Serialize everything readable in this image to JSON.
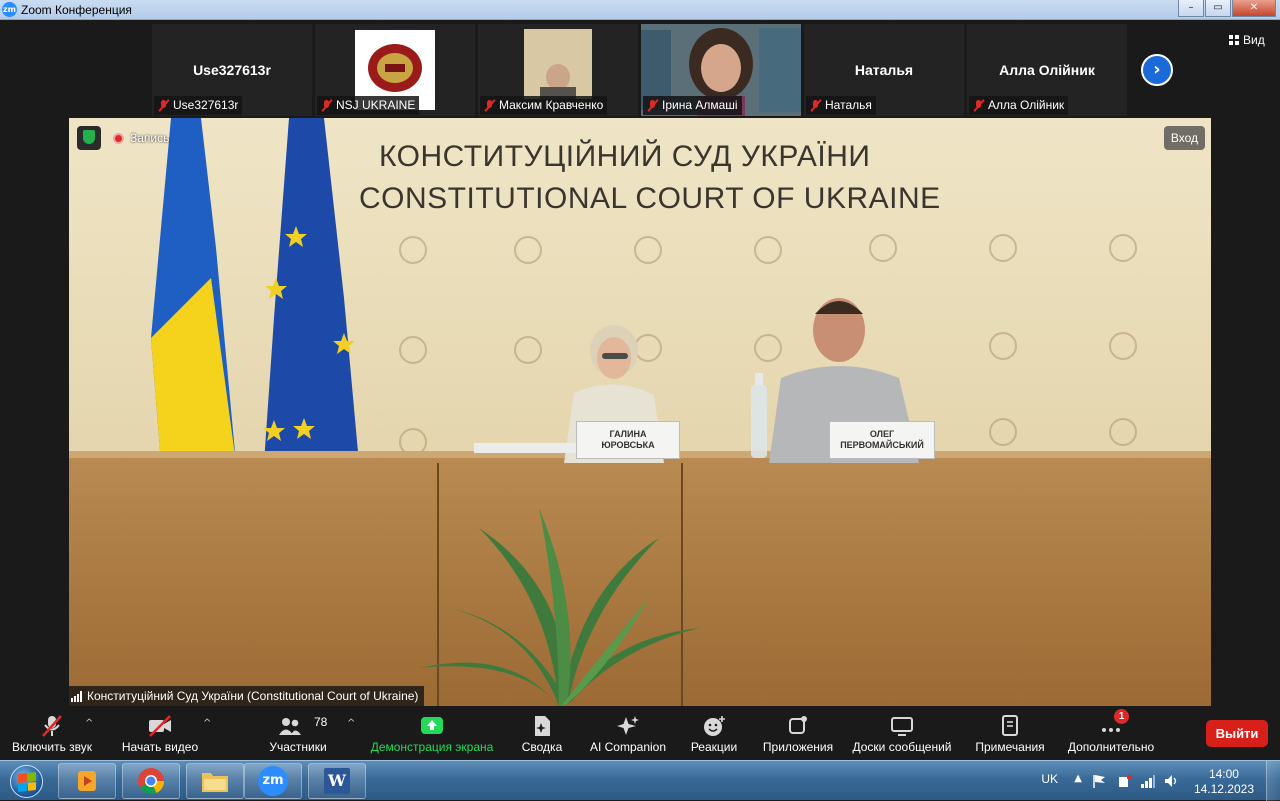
{
  "window": {
    "title": "Zoom Конференция",
    "logo_text": "zm",
    "controls": [
      "–",
      "▭",
      "✕"
    ]
  },
  "strip": {
    "tiles": [
      {
        "name_big": "Use327613r",
        "label": "Use327613r",
        "kind": "name"
      },
      {
        "name_big": "",
        "label": "NSJ UKRAINE",
        "kind": "logo"
      },
      {
        "name_big": "",
        "label": "Максим Кравченко",
        "kind": "photo"
      },
      {
        "name_big": "",
        "label": "Ірина Алмаші",
        "kind": "photo"
      },
      {
        "name_big": "Наталья",
        "label": "Наталья",
        "kind": "name"
      },
      {
        "name_big": "Алла Олійник",
        "label": "Алла Олійник",
        "kind": "name"
      }
    ],
    "next_icon": "›",
    "view_label": "Вид"
  },
  "stage": {
    "heading_ua": "КОНСТИТУЦІЙНИЙ СУД УКРАЇНИ",
    "heading_en": "CONSTITUTIONAL COURT OF UKRAINE",
    "recording_label": "Запись",
    "enter_label": "Вход",
    "speaker_label": "Конституційний Суд України (Constitutional Court of Ukraine)",
    "nameplate_1": "ГАЛИНА\nЮРОВСЬКА",
    "nameplate_2": "ОЛЕГ\nПЕРВОМАЙСЬКИЙ",
    "colors": {
      "ua_blue": "#1f5fc4",
      "ua_yellow": "#f5d21b",
      "eu_blue": "#1d4aa8",
      "eu_star": "#f2d023"
    }
  },
  "toolbar": {
    "items": [
      {
        "label": "Включить звук",
        "icon": "mic-muted-icon"
      },
      {
        "label": "Начать видео",
        "icon": "video-off-icon"
      },
      {
        "label": "Участники",
        "icon": "participants-icon",
        "count": "78"
      },
      {
        "label": "Демонстрация экрана",
        "icon": "share-screen-icon"
      },
      {
        "label": "Сводка",
        "icon": "summary-icon"
      },
      {
        "label": "AI Companion",
        "icon": "ai-companion-icon"
      },
      {
        "label": "Реакции",
        "icon": "reactions-icon"
      },
      {
        "label": "Приложения",
        "icon": "apps-icon"
      },
      {
        "label": "Доски сообщений",
        "icon": "whiteboards-icon"
      },
      {
        "label": "Примечания",
        "icon": "notes-icon"
      },
      {
        "label": "Дополнительно",
        "icon": "more-icon",
        "badge": "1"
      }
    ],
    "leave_label": "Выйти",
    "share_color": "#23d959",
    "leave_color": "#d7201a"
  },
  "taskbar": {
    "apps": [
      "media-player-icon",
      "chrome-icon",
      "file-explorer-icon",
      "zoom-icon",
      "word-icon"
    ],
    "zoom_text": "zm",
    "word_text": "W",
    "language": "UK",
    "time": "14:00",
    "date": "14.12.2023"
  }
}
